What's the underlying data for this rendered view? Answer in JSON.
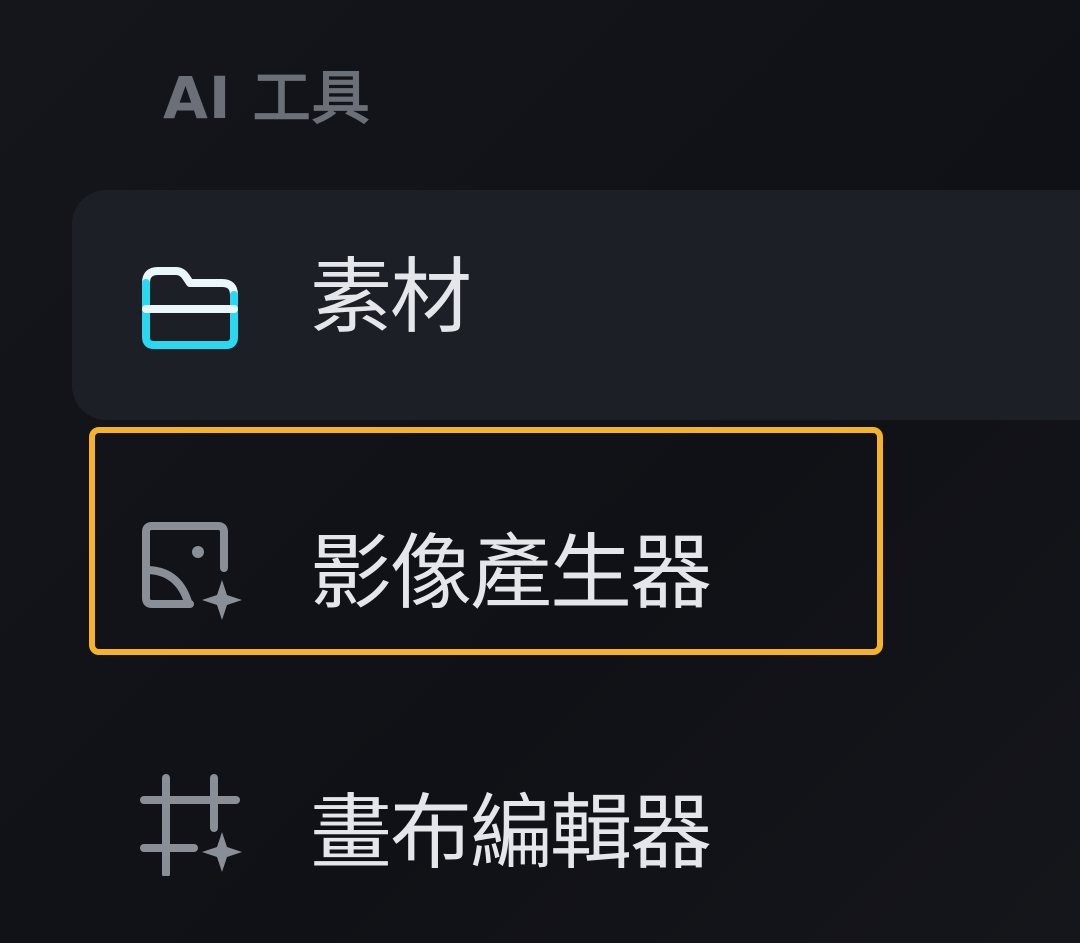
{
  "sidebar": {
    "section_title": "AI 工具",
    "items": [
      {
        "label": "素材",
        "icon": "folder-icon",
        "active": true,
        "icon_color": "#2ad8ef"
      },
      {
        "label": "影像產生器",
        "icon": "image-sparkle-icon",
        "active": false,
        "highlighted": true,
        "icon_color": "#8a8e96"
      },
      {
        "label": "畫布編輯器",
        "icon": "crop-sparkle-icon",
        "active": false,
        "icon_color": "#8a8e96"
      }
    ]
  },
  "colors": {
    "background": "#121318",
    "active_item_bg": "#1d1f26",
    "highlight_border": "#f5b325",
    "text_primary": "#e4e6ea",
    "text_muted": "#6b6f78"
  }
}
